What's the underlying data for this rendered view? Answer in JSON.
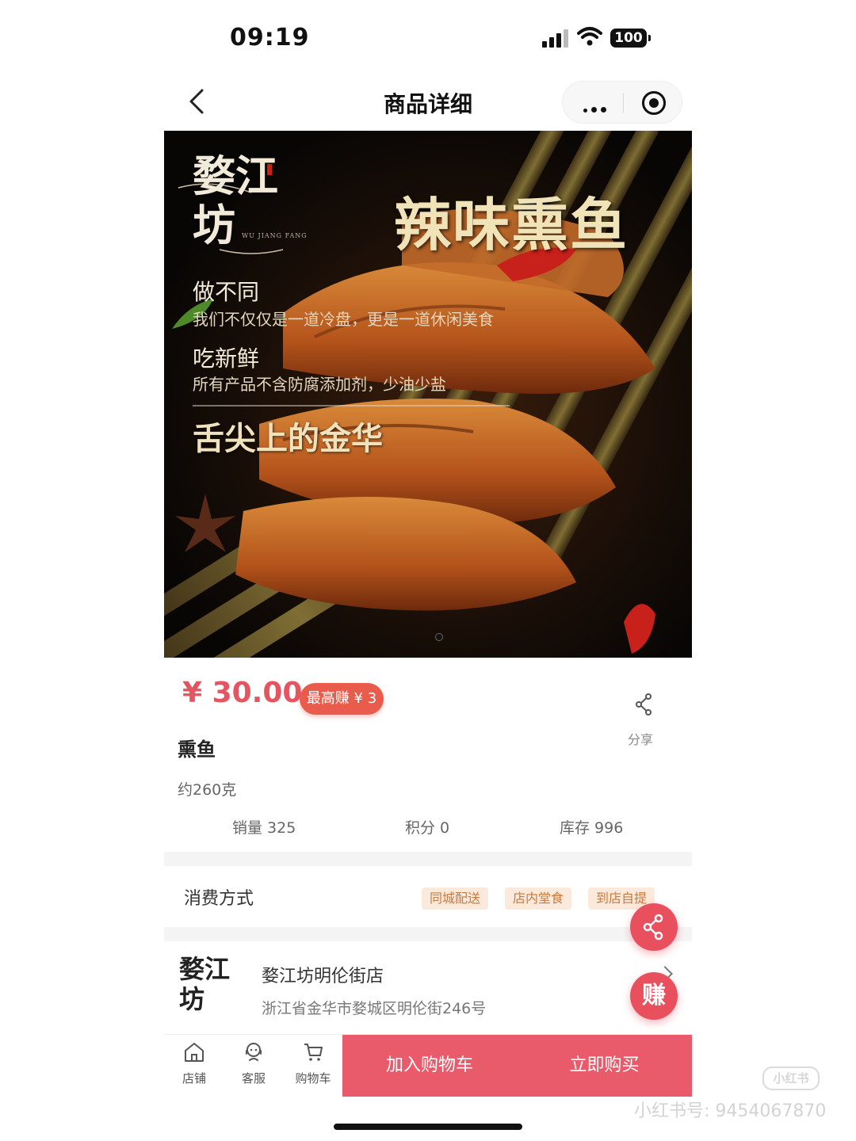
{
  "status_bar": {
    "time": "09:19",
    "battery": "100"
  },
  "nav": {
    "title": "商品详细"
  },
  "hero": {
    "brand_logo": "婺江坊",
    "brand_sub": "WU JIANG FANG",
    "title": "辣味熏鱼",
    "slogan1": "做不同",
    "slogan1_sub": "我们不仅仅是一道冷盘，更是一道休闲美食",
    "slogan2": "吃新鲜",
    "slogan2_sub": "所有产品不含防腐添加剂，少油少盐",
    "slogan3": "舌尖上的金华"
  },
  "product": {
    "price": "¥ 30.00",
    "earn_badge": "最高赚 ¥ 3",
    "name": "熏鱼",
    "spec": "约260克",
    "share_label": "分享",
    "stats": {
      "sales": "销量 325",
      "points": "积分 0",
      "stock": "库存 996"
    }
  },
  "consumption": {
    "label": "消费方式",
    "tags": [
      "同城配送",
      "店内堂食",
      "到店自提"
    ]
  },
  "store": {
    "logo_text": "婺江坊",
    "name": "婺江坊明伦街店",
    "address": "浙江省金华市婺城区明伦街246号"
  },
  "floating": {
    "earn_label": "赚"
  },
  "bottom_bar": {
    "tabs": [
      {
        "label": "店铺",
        "icon": "store-icon"
      },
      {
        "label": "客服",
        "icon": "customer-service-icon"
      },
      {
        "label": "购物车",
        "icon": "cart-icon"
      }
    ],
    "add_to_cart": "加入购物车",
    "buy_now": "立即购买"
  },
  "watermark": {
    "text": "小红书号: 9454067870",
    "logo": "小红书"
  },
  "colors": {
    "accent": "#e95b6a",
    "price": "#e45461",
    "tag_bg": "#fbeadb",
    "tag_text": "#c77a3e"
  }
}
